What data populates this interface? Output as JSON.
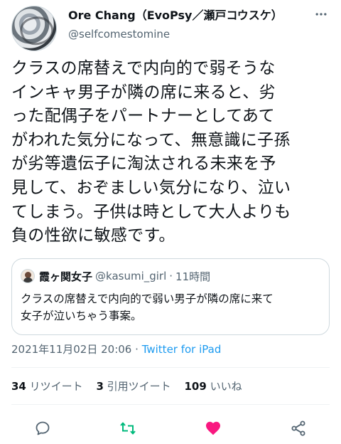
{
  "author": {
    "name": "Ore Chang（EvoPsy／瀬戸コウスケ）",
    "handle": "@selfcomestomine"
  },
  "more_icon": "ellipsis-icon",
  "tweet": {
    "text": "クラスの席替えで内向的で弱そうな\nインキャ男子が隣の席に来ると、劣\nった配偶子をパートナーとしてあて\nがわれた気分になって、無意識に子孫\nが劣等遺伝子に淘汰される未来を予\n見して、おぞましい気分になり、泣い\nてしまう。子供は時として大人よりも\n負の性欲に敏感です。"
  },
  "quote": {
    "name": "霞ヶ関女子",
    "handle": "@kasumi_girl",
    "separator": "·",
    "time": "11時間",
    "text": "クラスの席替えで内向的で弱い男子が隣の席に来て\n女子が泣いちゃう事案。"
  },
  "meta": {
    "timestamp": "2021年11月02日 20:06",
    "separator": "·",
    "source": "Twitter for iPad"
  },
  "stats": {
    "retweets_count": "34",
    "retweets_label": "リツイート",
    "quotes_count": "3",
    "quotes_label": "引用ツイート",
    "likes_count": "109",
    "likes_label": "いいね"
  },
  "actions": {
    "reply_icon": "reply-icon",
    "retweet_icon": "retweet-icon",
    "like_icon": "heart-icon",
    "share_icon": "share-icon",
    "colors": {
      "retweet": "#00ba7c",
      "like": "#f91880",
      "default": "#536471"
    }
  }
}
